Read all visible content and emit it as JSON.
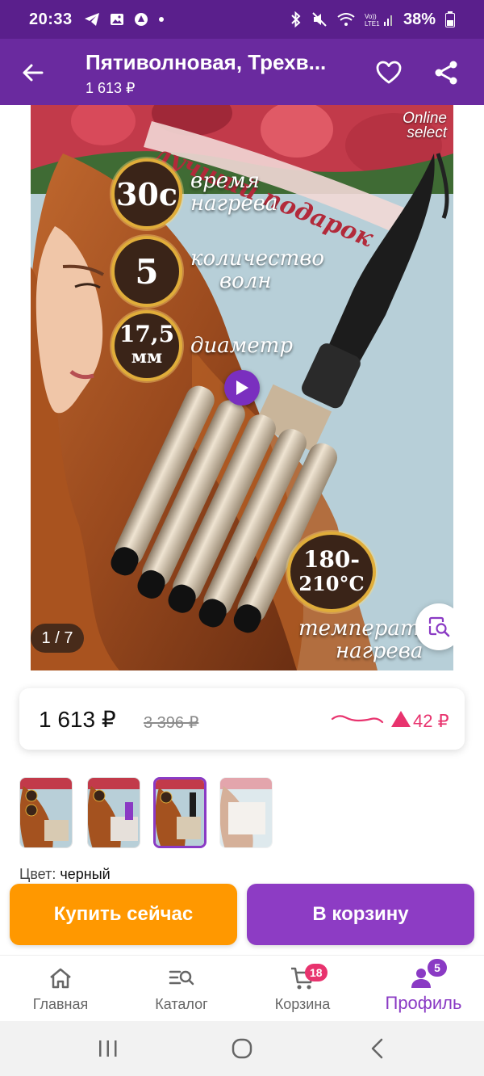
{
  "status_bar": {
    "time": "20:33",
    "battery": "38%",
    "network": "VoLTE1",
    "left_icons": [
      "telegram-icon",
      "image-icon",
      "app-icon",
      "dot-icon"
    ],
    "right_icons": [
      "bluetooth-icon",
      "mute-icon",
      "wifi-icon",
      "signal-icon",
      "battery-icon"
    ]
  },
  "app_bar": {
    "title": "Пятиволновая, Трехв...",
    "subtitle": "1 613 ₽"
  },
  "product_image": {
    "counter": "1 / 7",
    "brand": [
      "Online",
      "select"
    ],
    "banner": "лучший подарок",
    "badges": [
      {
        "value": "30с",
        "label": [
          "время",
          "нагрева"
        ]
      },
      {
        "value": "5",
        "label": [
          "количество",
          "волн"
        ]
      },
      {
        "value": [
          "17,5",
          "мм"
        ],
        "label": [
          "диаметр"
        ]
      },
      {
        "value": [
          "180-",
          "210°С"
        ],
        "label": [
          "температура",
          "нагрева"
        ]
      }
    ]
  },
  "price_card": {
    "current": "1 613 ₽",
    "old": "3 396 ₽",
    "delta": "42 ₽"
  },
  "thumbnails": {
    "count": 4,
    "active_index": 2
  },
  "color": {
    "label": "Цвет:",
    "value": "черный"
  },
  "actions": {
    "buy_now": "Купить сейчас",
    "add_to_cart": "В корзину"
  },
  "bottom_nav": {
    "items": [
      {
        "label": "Главная",
        "icon": "home-icon"
      },
      {
        "label": "Каталог",
        "icon": "catalog-search-icon"
      },
      {
        "label": "Корзина",
        "icon": "cart-icon",
        "badge": "18"
      },
      {
        "label": "Профиль",
        "icon": "profile-icon",
        "badge": "5",
        "active": true
      }
    ]
  },
  "colors": {
    "status_bar": "#5a1f8c",
    "app_bar": "#6a2a9f",
    "accent": "#8a3ac4",
    "buy": "#ff9800",
    "price_up": "#e8336e"
  }
}
